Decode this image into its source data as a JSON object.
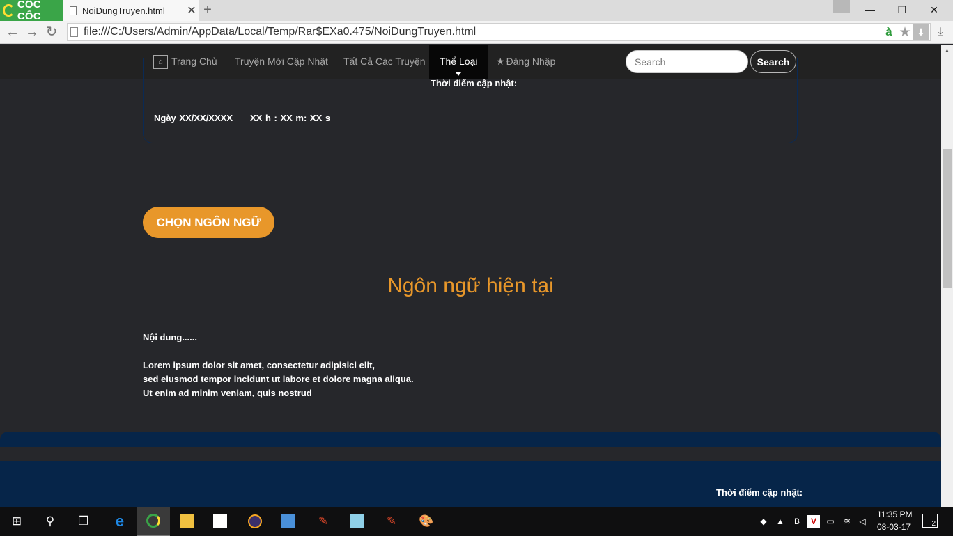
{
  "browser": {
    "brand": "CỐC CỐC",
    "tab_title": "NoiDungTruyen.html",
    "new_tab": "+",
    "url": "file:///C:/Users/Admin/AppData/Local/Temp/Rar$EXa0.475/NoiDungTruyen.html",
    "translate_glyph": "à",
    "window_controls": {
      "minimize": "—",
      "restore": "❐",
      "close": "✕"
    }
  },
  "navbar": {
    "items": [
      {
        "label": "Trang Chủ",
        "icon": "home-icon"
      },
      {
        "label": "Truyện Mới Cập Nhật"
      },
      {
        "label": "Tất Cả Các Truyện"
      },
      {
        "label": "Thể Loại",
        "active": true
      },
      {
        "label": "Đăng Nhập",
        "icon": "star-icon"
      }
    ],
    "search_placeholder": "Search",
    "search_button": "Search"
  },
  "update_panel": {
    "label": "Thời điểm cập nhật:",
    "date": "Ngày XX/XX/XXXX",
    "time": "XX h :  XX  m: XX s"
  },
  "language": {
    "button": "CHỌN NGÔN NGỮ",
    "current": "Ngôn ngữ hiện tại"
  },
  "content": {
    "title": "Nội dung......",
    "lines": [
      "Lorem ipsum dolor sit amet, consectetur adipisici elit,",
      "sed eiusmod tempor incidunt ut labore et dolore magna aliqua.",
      "Ut enim ad minim veniam, quis nostrud"
    ]
  },
  "footer": {
    "label": "Thời điểm cập nhật:"
  },
  "taskbar": {
    "clock_time": "11:35 PM",
    "clock_date": "08-03-17",
    "notifications": "2"
  },
  "colors": {
    "accent": "#e8972a",
    "page_bg": "#26272b",
    "navbar_bg": "#222222",
    "footer_bg": "#062549",
    "brand_green": "#3aa548"
  }
}
